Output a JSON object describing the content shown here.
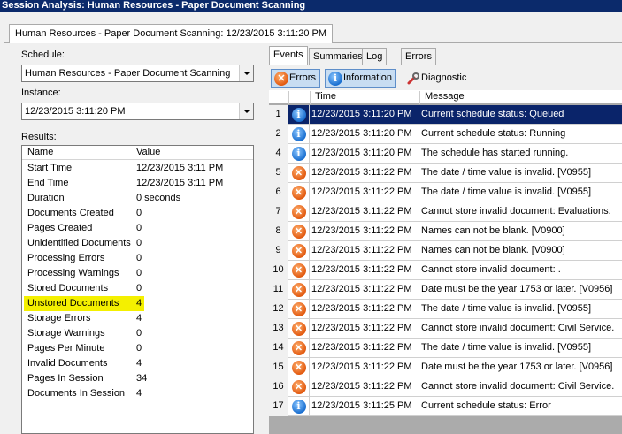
{
  "window": {
    "title": "Session Analysis: Human Resources - Paper Document Scanning"
  },
  "outer_tab": {
    "label": "Human Resources - Paper Document Scanning: 12/23/2015 3:11:20 PM"
  },
  "schedule": {
    "label": "Schedule:",
    "value": "Human Resources - Paper Document Scanning"
  },
  "instance": {
    "label": "Instance:",
    "value": "12/23/2015 3:11:20 PM"
  },
  "results": {
    "label": "Results:",
    "headers": {
      "name": "Name",
      "value": "Value"
    },
    "rows": [
      {
        "name": "Start Time",
        "value": "12/23/2015 3:11 PM"
      },
      {
        "name": "End Time",
        "value": "12/23/2015 3:11 PM"
      },
      {
        "name": "Duration",
        "value": "0 seconds"
      },
      {
        "name": "Documents Created",
        "value": "0"
      },
      {
        "name": "Pages Created",
        "value": "0"
      },
      {
        "name": "Unidentified Documents",
        "value": "0"
      },
      {
        "name": "Processing Errors",
        "value": "0"
      },
      {
        "name": "Processing Warnings",
        "value": "0"
      },
      {
        "name": "Stored Documents",
        "value": "0"
      },
      {
        "name": "Unstored Documents",
        "value": "4",
        "highlight": true
      },
      {
        "name": "Storage Errors",
        "value": "4"
      },
      {
        "name": "Storage Warnings",
        "value": "0"
      },
      {
        "name": "Pages Per Minute",
        "value": "0"
      },
      {
        "name": "Invalid Documents",
        "value": "4"
      },
      {
        "name": "Pages In Session",
        "value": "34"
      },
      {
        "name": "Documents In Session",
        "value": "4"
      }
    ]
  },
  "tabs": [
    {
      "label": "Events",
      "active": true
    },
    {
      "label": "Summaries"
    },
    {
      "label": "Log"
    },
    {
      "label": "Errors"
    }
  ],
  "toolbar": {
    "errors_label": "Errors",
    "information_label": "Information",
    "diagnostic_label": "Diagnostic"
  },
  "events": {
    "headers": {
      "time": "Time",
      "message": "Message"
    },
    "rows": [
      {
        "num": "1",
        "type": "info",
        "time": "12/23/2015 3:11:20 PM",
        "message": "Current schedule status: Queued",
        "selected": true
      },
      {
        "num": "2",
        "type": "info",
        "time": "12/23/2015 3:11:20 PM",
        "message": "Current schedule status: Running"
      },
      {
        "num": "4",
        "type": "info",
        "time": "12/23/2015 3:11:20 PM",
        "message": "The schedule has started running."
      },
      {
        "num": "5",
        "type": "error",
        "time": "12/23/2015 3:11:22 PM",
        "message": "The date / time value is invalid. [V0955]"
      },
      {
        "num": "6",
        "type": "error",
        "time": "12/23/2015 3:11:22 PM",
        "message": "The date / time value is invalid. [V0955]"
      },
      {
        "num": "7",
        "type": "error",
        "time": "12/23/2015 3:11:22 PM",
        "message": "Cannot store invalid document: Evaluations."
      },
      {
        "num": "8",
        "type": "error",
        "time": "12/23/2015 3:11:22 PM",
        "message": "Names can not be blank. [V0900]"
      },
      {
        "num": "9",
        "type": "error",
        "time": "12/23/2015 3:11:22 PM",
        "message": "Names can not be blank. [V0900]"
      },
      {
        "num": "10",
        "type": "error",
        "time": "12/23/2015 3:11:22 PM",
        "message": "Cannot store invalid document: ."
      },
      {
        "num": "11",
        "type": "error",
        "time": "12/23/2015 3:11:22 PM",
        "message": "Date must be the year 1753 or later.  [V0956]"
      },
      {
        "num": "12",
        "type": "error",
        "time": "12/23/2015 3:11:22 PM",
        "message": "The date / time value is invalid. [V0955]"
      },
      {
        "num": "13",
        "type": "error",
        "time": "12/23/2015 3:11:22 PM",
        "message": "Cannot store invalid document: Civil Service."
      },
      {
        "num": "14",
        "type": "error",
        "time": "12/23/2015 3:11:22 PM",
        "message": "The date / time value is invalid. [V0955]"
      },
      {
        "num": "15",
        "type": "error",
        "time": "12/23/2015 3:11:22 PM",
        "message": "Date must be the year 1753 or later.  [V0956]"
      },
      {
        "num": "16",
        "type": "error",
        "time": "12/23/2015 3:11:22 PM",
        "message": "Cannot store invalid document: Civil Service."
      },
      {
        "num": "17",
        "type": "info",
        "time": "12/23/2015 3:11:25 PM",
        "message": "Current schedule status: Error"
      }
    ]
  },
  "icons": {
    "info": "info-icon",
    "error": "error-icon",
    "diagnostic": "wrench-icon"
  }
}
